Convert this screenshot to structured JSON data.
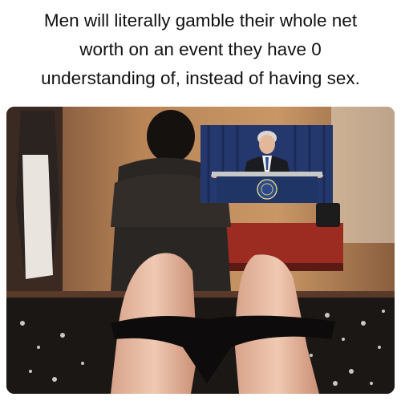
{
  "caption": {
    "lines": [
      "Men will literally gamble their whole net",
      "worth on an event they have 0",
      "understanding of, instead of having sex."
    ]
  },
  "photo": {
    "subject": "bedroom-scene-person-watching-tv",
    "inset_subject": "speaker-at-podium-press-conference"
  },
  "colors": {
    "background": "#ffffff",
    "caption_text": "#111111",
    "wall": "#b07a4c",
    "podium_blue": "#1f3565",
    "curtain_blue": "#24386e"
  }
}
